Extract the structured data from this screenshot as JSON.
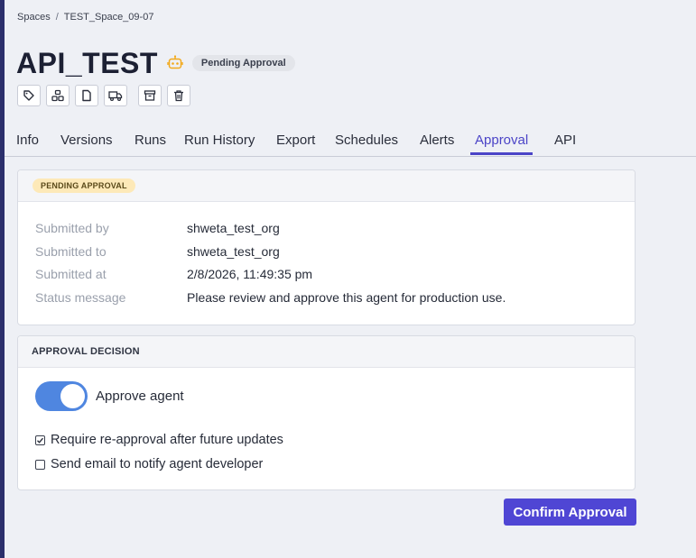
{
  "breadcrumb": {
    "root": "Spaces",
    "separator": "/",
    "current": "TEST_Space_09-07"
  },
  "header": {
    "title": "API_TEST",
    "status_pill": "Pending Approval",
    "icon": "robot-icon",
    "icon_color": "#f2a91b"
  },
  "toolbar": {
    "icons": [
      "tag-icon",
      "agents-icon",
      "document-icon",
      "deploy-truck-icon",
      "archive-icon",
      "trash-icon"
    ]
  },
  "tabs": [
    {
      "label": "Info"
    },
    {
      "label": "Versions"
    },
    {
      "label": "Runs"
    },
    {
      "label": "Run History"
    },
    {
      "label": "Export"
    },
    {
      "label": "Schedules"
    },
    {
      "label": "Alerts"
    },
    {
      "label": "Approval",
      "active": true
    },
    {
      "label": "API"
    }
  ],
  "pending_card": {
    "badge": "PENDING APPROVAL",
    "rows": [
      {
        "label": "Submitted by",
        "value": "shweta_test_org"
      },
      {
        "label": "Submitted to",
        "value": "shweta_test_org"
      },
      {
        "label": "Submitted at",
        "value": "2/8/2026, 11:49:35 pm"
      },
      {
        "label": "Status message",
        "value": "Please review and approve this agent for production use."
      }
    ]
  },
  "decision_card": {
    "header": "APPROVAL DECISION",
    "toggle_label": "Approve agent",
    "toggle_on": true,
    "require_reapproval": {
      "label": "Require re-approval after future updates",
      "checked": true
    },
    "send_email": {
      "label": "Send email to notify agent developer",
      "checked": false
    }
  },
  "confirm_button": "Confirm Approval",
  "colors": {
    "accent": "#4f46d4",
    "toggle": "#4f86e0",
    "pending_badge_bg": "#fde9b8"
  }
}
